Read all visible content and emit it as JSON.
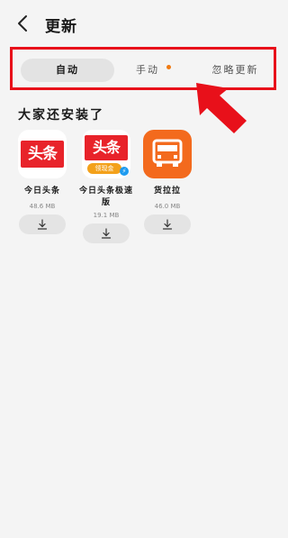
{
  "header": {
    "title": "更新",
    "back_icon": "chevron-left-icon"
  },
  "tabs": [
    {
      "label": "自动",
      "active": true
    },
    {
      "label": "手动",
      "active": false,
      "has_dot": true
    },
    {
      "label": "忽略更新",
      "active": false
    }
  ],
  "colors": {
    "highlight_frame": "#e8101a",
    "arrow": "#e8101a",
    "dot": "#f07a12",
    "background": "#f4f4f4"
  },
  "section": {
    "title": "大家还安装了"
  },
  "apps": [
    {
      "name": "今日头条",
      "size": "48.6 MB",
      "icon_text": "头条"
    },
    {
      "name": "今日头条极速版",
      "size": "19.1 MB",
      "icon_text": "头条",
      "icon_badge": "领现金"
    },
    {
      "name": "货拉拉",
      "size": "46.0 MB"
    }
  ]
}
